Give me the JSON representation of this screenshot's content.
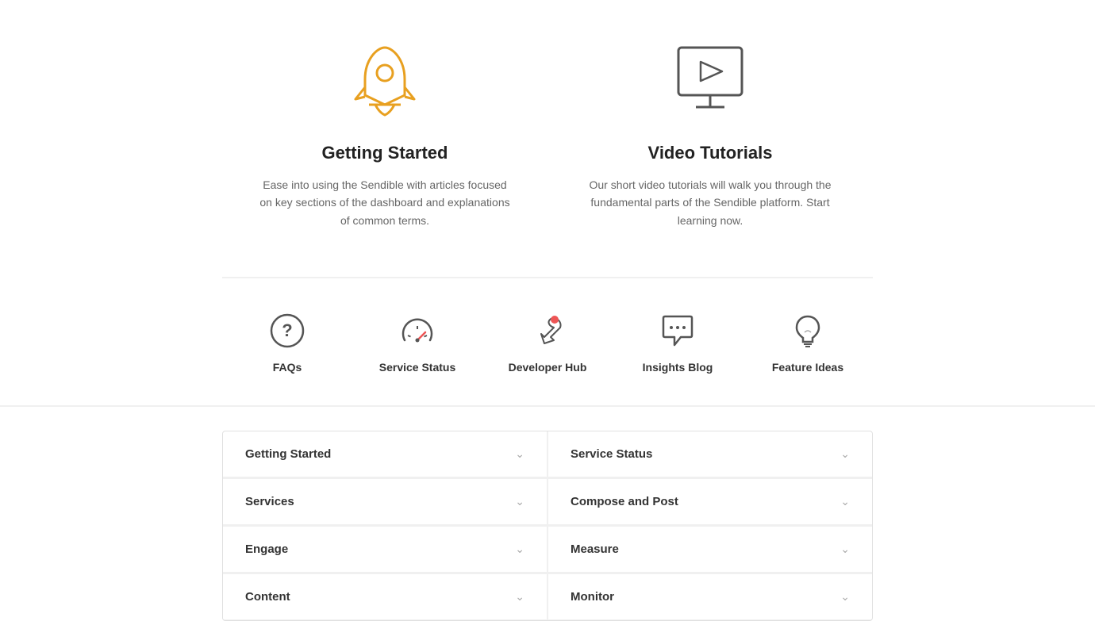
{
  "top_cards": [
    {
      "id": "getting-started",
      "title": "Getting Started",
      "description": "Ease into using the Sendible with articles focused on key sections of the dashboard and explanations of common terms.",
      "icon": "rocket"
    },
    {
      "id": "video-tutorials",
      "title": "Video Tutorials",
      "description": "Our short video tutorials will walk you through the fundamental parts of the Sendible platform. Start learning now.",
      "icon": "monitor-play"
    }
  ],
  "nav_icons": [
    {
      "id": "faqs",
      "label": "FAQs",
      "icon": "question-circle"
    },
    {
      "id": "service-status",
      "label": "Service Status",
      "icon": "speedometer"
    },
    {
      "id": "developer-hub",
      "label": "Developer Hub",
      "icon": "dev-tool"
    },
    {
      "id": "insights-blog",
      "label": "Insights Blog",
      "icon": "chat-bubble"
    },
    {
      "id": "feature-ideas",
      "label": "Feature Ideas",
      "icon": "lightbulb"
    }
  ],
  "accordion_items": [
    {
      "id": "getting-started-acc",
      "label": "Getting Started"
    },
    {
      "id": "service-status-acc",
      "label": "Service Status"
    },
    {
      "id": "services-acc",
      "label": "Services"
    },
    {
      "id": "compose-and-post-acc",
      "label": "Compose and Post"
    },
    {
      "id": "engage-acc",
      "label": "Engage"
    },
    {
      "id": "measure-acc",
      "label": "Measure"
    },
    {
      "id": "content-acc",
      "label": "Content"
    },
    {
      "id": "monitor-acc",
      "label": "Monitor"
    }
  ]
}
